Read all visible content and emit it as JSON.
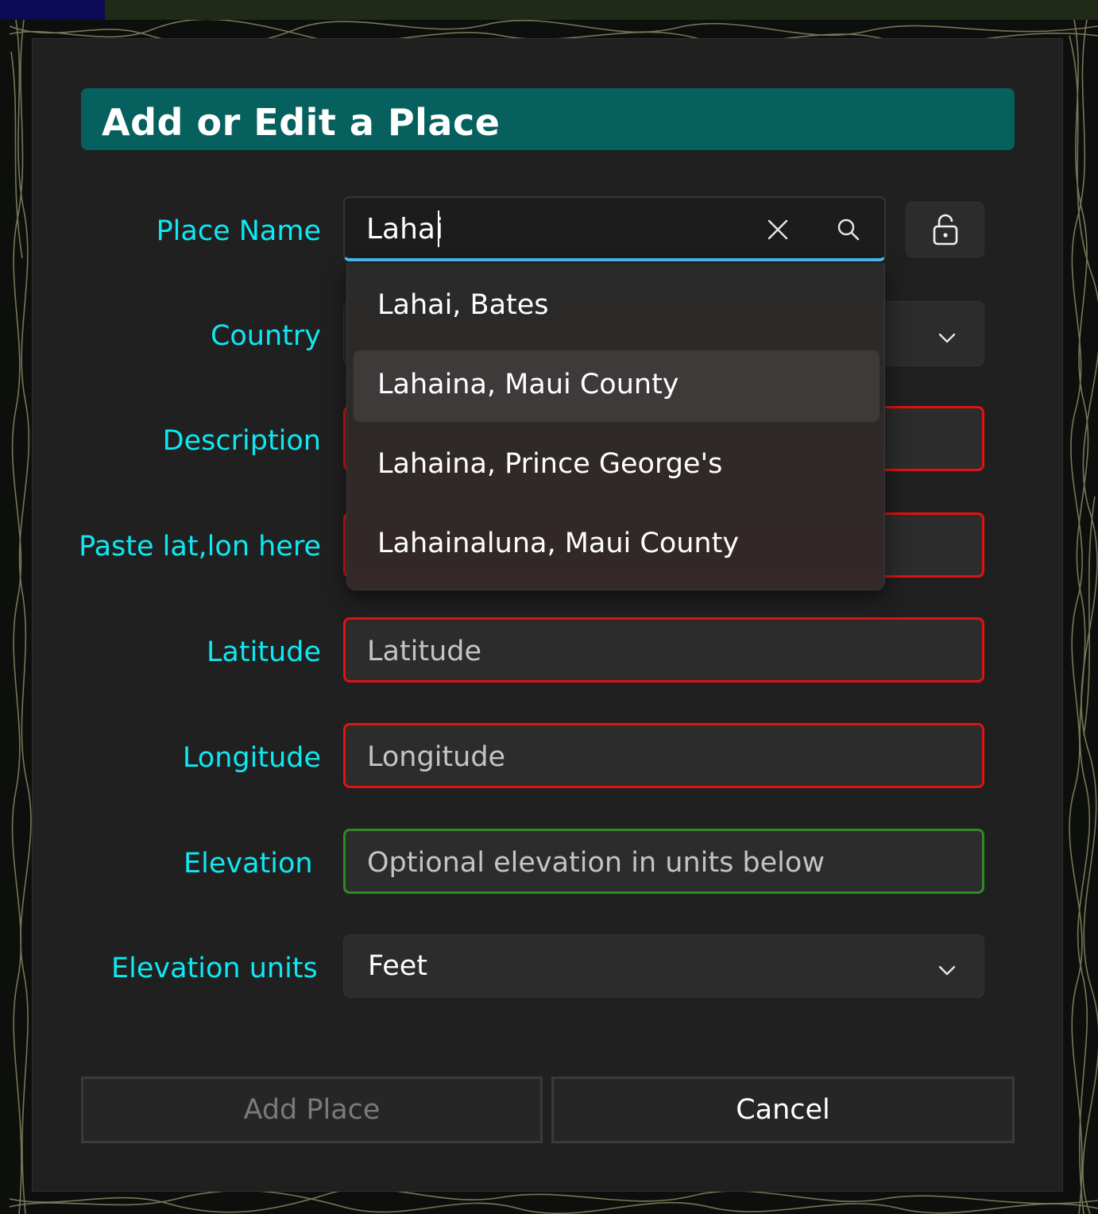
{
  "dialog": {
    "title": "Add or Edit a Place"
  },
  "fields": {
    "place_name": {
      "label": "Place Name",
      "value": "Lahai"
    },
    "country": {
      "label": "Country"
    },
    "description": {
      "label": "Description"
    },
    "paste_latlon": {
      "label": "Paste lat,lon here"
    },
    "latitude": {
      "label": "Latitude",
      "placeholder": "Latitude"
    },
    "longitude": {
      "label": "Longitude",
      "placeholder": "Longitude"
    },
    "elevation": {
      "label": "Elevation",
      "placeholder": "Optional elevation in units below"
    },
    "elevation_units": {
      "label": "Elevation units",
      "value": "Feet"
    }
  },
  "suggestions": [
    {
      "label": "Lahai, Bates"
    },
    {
      "label": "Lahaina, Maui County"
    },
    {
      "label": "Lahaina, Prince George's"
    },
    {
      "label": "Lahainaluna, Maui County"
    }
  ],
  "buttons": {
    "add_place": "Add Place",
    "cancel": "Cancel"
  },
  "icons": {
    "clear": "close-icon",
    "search": "search-icon",
    "lock": "lock-icon",
    "dropdown": "chevron-down-icon"
  },
  "colors": {
    "title_bar": "#05605e",
    "label": "#0ee8f2",
    "invalid_border": "#e01212",
    "valid_border": "#2e8b22",
    "focus_underline": "#4cc2ff"
  }
}
